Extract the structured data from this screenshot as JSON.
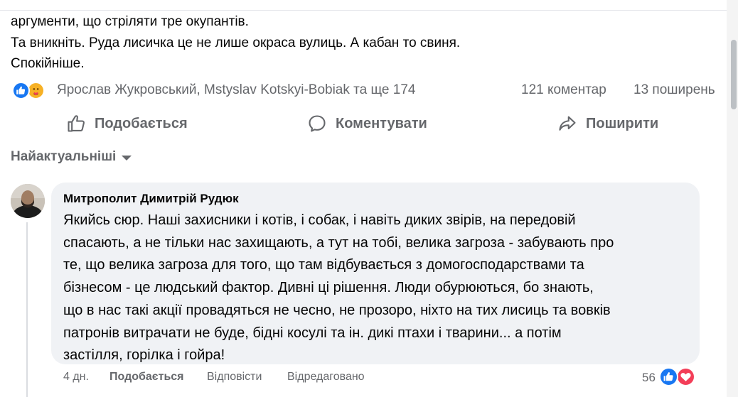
{
  "post": {
    "lines": [
      "аргументи, що стріляти тре окупантів.",
      "Та вникніть. Руда лисичка це не лише окраса вулиць. А кабан то свиня.",
      "Спокійніше."
    ]
  },
  "reactions": {
    "icons": [
      "like-icon",
      "care-icon"
    ],
    "names": "Ярослав Жукровський, Mstyslav Kotskyi-Bobiak та ще 174",
    "comments": "121 коментар",
    "shares": "13 поширень"
  },
  "actions": {
    "like": "Подобається",
    "comment": "Коментувати",
    "share": "Поширити"
  },
  "sort": {
    "label": "Найактуальніші"
  },
  "comment": {
    "author": "Митрополит Димитрій Рудюк",
    "lines": [
      "Якийсь сюр. Наші захисники і котів, і собак, і навіть диких звірів, на передовій",
      "спасають, а не тільки нас захищають, а тут на тобі, велика загроза - забувають про",
      "те, що велика загроза для того, що там відбувається з домогосподарствами та",
      "бізнесом - це людський фактор. Дивні ці рішення. Люди обурюються, бо знають,",
      "що в нас такі акції провадяться не чесно, не прозоро, ніхто на тих лисиць та вовків",
      "патронів витрачати не буде, бідні косулі та ін. дикі птахи і тварини... а потім",
      "застілля, горілка і гойра!"
    ],
    "time": "4 дн.",
    "like": "Подобається",
    "reply": "Відповісти",
    "edited": "Відредаговано",
    "reaction_count": "56",
    "reaction_icons": [
      "like-icon",
      "love-icon"
    ]
  },
  "colors": {
    "text": "#050505",
    "secondary": "#65676b",
    "bubble": "#f0f2f5",
    "like_blue": "#1877f2",
    "love_red": "#f33e58",
    "care_yellow": "#f7b125"
  }
}
